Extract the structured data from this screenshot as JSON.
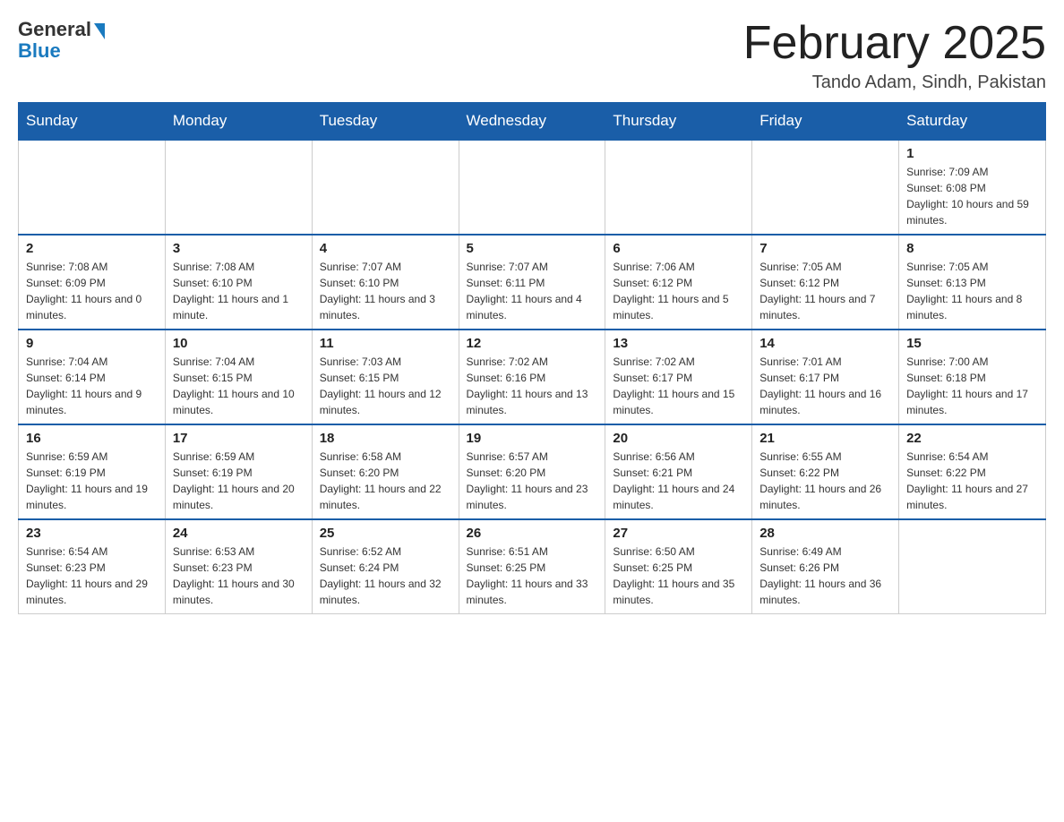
{
  "header": {
    "logo_general": "General",
    "logo_blue": "Blue",
    "month_title": "February 2025",
    "location": "Tando Adam, Sindh, Pakistan"
  },
  "days_of_week": [
    "Sunday",
    "Monday",
    "Tuesday",
    "Wednesday",
    "Thursday",
    "Friday",
    "Saturday"
  ],
  "weeks": [
    [
      {
        "day": "",
        "info": ""
      },
      {
        "day": "",
        "info": ""
      },
      {
        "day": "",
        "info": ""
      },
      {
        "day": "",
        "info": ""
      },
      {
        "day": "",
        "info": ""
      },
      {
        "day": "",
        "info": ""
      },
      {
        "day": "1",
        "info": "Sunrise: 7:09 AM\nSunset: 6:08 PM\nDaylight: 10 hours and 59 minutes."
      }
    ],
    [
      {
        "day": "2",
        "info": "Sunrise: 7:08 AM\nSunset: 6:09 PM\nDaylight: 11 hours and 0 minutes."
      },
      {
        "day": "3",
        "info": "Sunrise: 7:08 AM\nSunset: 6:10 PM\nDaylight: 11 hours and 1 minute."
      },
      {
        "day": "4",
        "info": "Sunrise: 7:07 AM\nSunset: 6:10 PM\nDaylight: 11 hours and 3 minutes."
      },
      {
        "day": "5",
        "info": "Sunrise: 7:07 AM\nSunset: 6:11 PM\nDaylight: 11 hours and 4 minutes."
      },
      {
        "day": "6",
        "info": "Sunrise: 7:06 AM\nSunset: 6:12 PM\nDaylight: 11 hours and 5 minutes."
      },
      {
        "day": "7",
        "info": "Sunrise: 7:05 AM\nSunset: 6:12 PM\nDaylight: 11 hours and 7 minutes."
      },
      {
        "day": "8",
        "info": "Sunrise: 7:05 AM\nSunset: 6:13 PM\nDaylight: 11 hours and 8 minutes."
      }
    ],
    [
      {
        "day": "9",
        "info": "Sunrise: 7:04 AM\nSunset: 6:14 PM\nDaylight: 11 hours and 9 minutes."
      },
      {
        "day": "10",
        "info": "Sunrise: 7:04 AM\nSunset: 6:15 PM\nDaylight: 11 hours and 10 minutes."
      },
      {
        "day": "11",
        "info": "Sunrise: 7:03 AM\nSunset: 6:15 PM\nDaylight: 11 hours and 12 minutes."
      },
      {
        "day": "12",
        "info": "Sunrise: 7:02 AM\nSunset: 6:16 PM\nDaylight: 11 hours and 13 minutes."
      },
      {
        "day": "13",
        "info": "Sunrise: 7:02 AM\nSunset: 6:17 PM\nDaylight: 11 hours and 15 minutes."
      },
      {
        "day": "14",
        "info": "Sunrise: 7:01 AM\nSunset: 6:17 PM\nDaylight: 11 hours and 16 minutes."
      },
      {
        "day": "15",
        "info": "Sunrise: 7:00 AM\nSunset: 6:18 PM\nDaylight: 11 hours and 17 minutes."
      }
    ],
    [
      {
        "day": "16",
        "info": "Sunrise: 6:59 AM\nSunset: 6:19 PM\nDaylight: 11 hours and 19 minutes."
      },
      {
        "day": "17",
        "info": "Sunrise: 6:59 AM\nSunset: 6:19 PM\nDaylight: 11 hours and 20 minutes."
      },
      {
        "day": "18",
        "info": "Sunrise: 6:58 AM\nSunset: 6:20 PM\nDaylight: 11 hours and 22 minutes."
      },
      {
        "day": "19",
        "info": "Sunrise: 6:57 AM\nSunset: 6:20 PM\nDaylight: 11 hours and 23 minutes."
      },
      {
        "day": "20",
        "info": "Sunrise: 6:56 AM\nSunset: 6:21 PM\nDaylight: 11 hours and 24 minutes."
      },
      {
        "day": "21",
        "info": "Sunrise: 6:55 AM\nSunset: 6:22 PM\nDaylight: 11 hours and 26 minutes."
      },
      {
        "day": "22",
        "info": "Sunrise: 6:54 AM\nSunset: 6:22 PM\nDaylight: 11 hours and 27 minutes."
      }
    ],
    [
      {
        "day": "23",
        "info": "Sunrise: 6:54 AM\nSunset: 6:23 PM\nDaylight: 11 hours and 29 minutes."
      },
      {
        "day": "24",
        "info": "Sunrise: 6:53 AM\nSunset: 6:23 PM\nDaylight: 11 hours and 30 minutes."
      },
      {
        "day": "25",
        "info": "Sunrise: 6:52 AM\nSunset: 6:24 PM\nDaylight: 11 hours and 32 minutes."
      },
      {
        "day": "26",
        "info": "Sunrise: 6:51 AM\nSunset: 6:25 PM\nDaylight: 11 hours and 33 minutes."
      },
      {
        "day": "27",
        "info": "Sunrise: 6:50 AM\nSunset: 6:25 PM\nDaylight: 11 hours and 35 minutes."
      },
      {
        "day": "28",
        "info": "Sunrise: 6:49 AM\nSunset: 6:26 PM\nDaylight: 11 hours and 36 minutes."
      },
      {
        "day": "",
        "info": ""
      }
    ]
  ]
}
